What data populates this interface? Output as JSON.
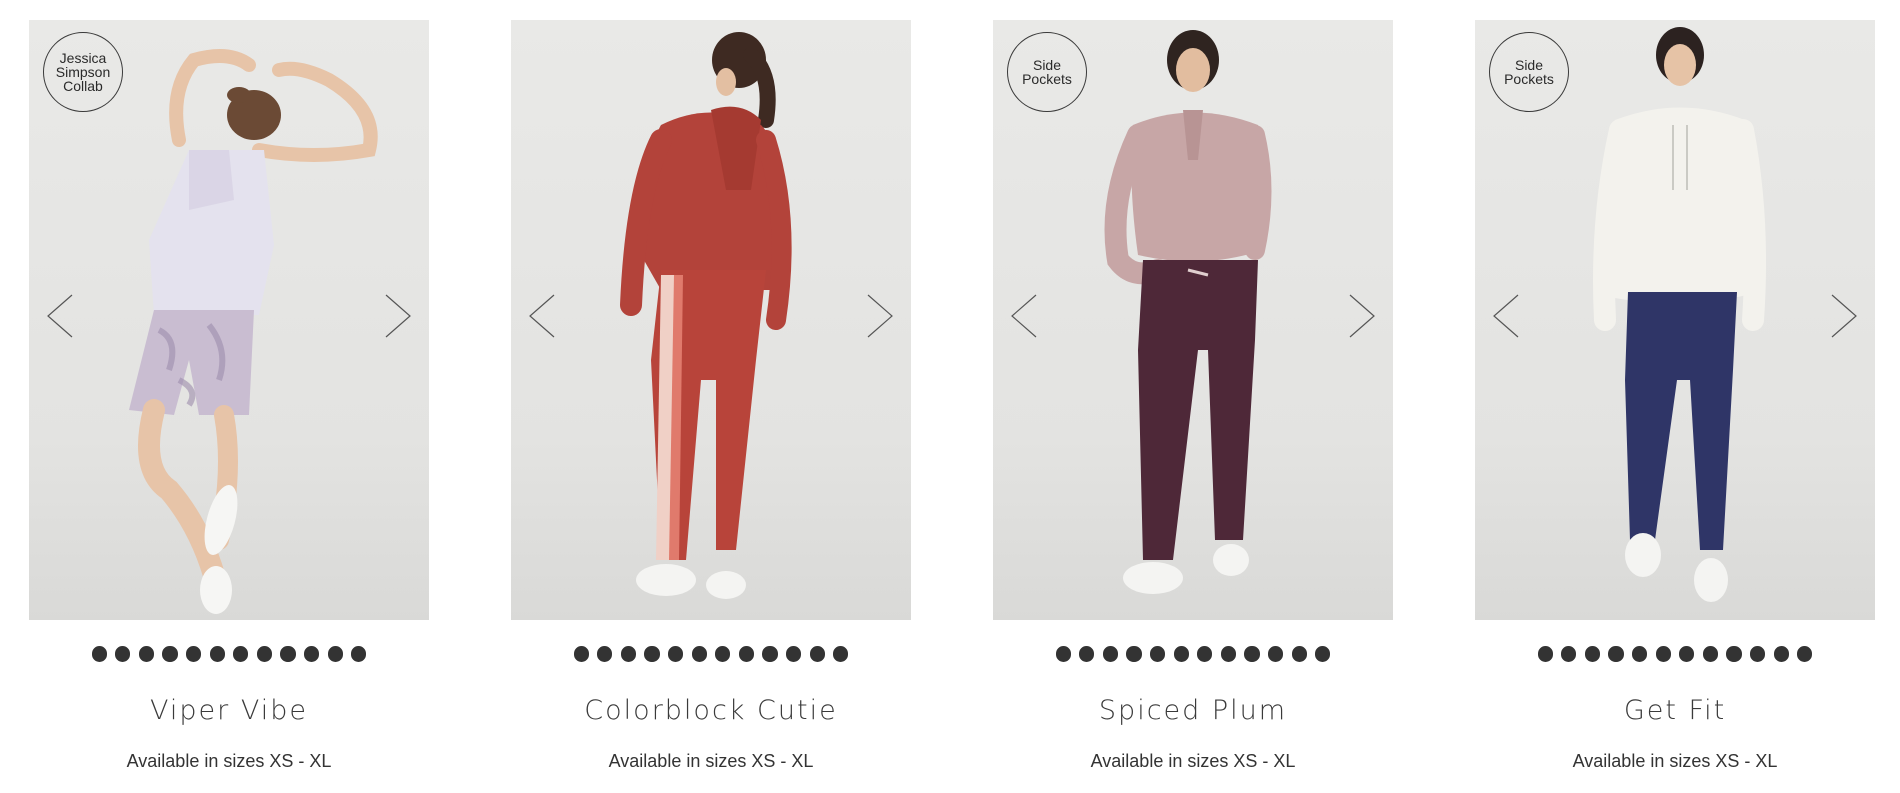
{
  "products": [
    {
      "name": "Viper Vibe",
      "sizes": "Available in sizes XS - XL",
      "badge": "Jessica Simpson Collab",
      "image_icon": "photo-model-tank-bike-shorts",
      "dot_count": 12,
      "colors": {
        "top": "#e4e2ee",
        "bottom": "#c9bdd1",
        "skin": "#e7c4a8",
        "hair": "#6b4a35"
      }
    },
    {
      "name": "Colorblock Cutie",
      "sizes": "Available in sizes XS - XL",
      "badge": "",
      "image_icon": "photo-model-red-hoodie-leggings",
      "dot_count": 12,
      "colors": {
        "top": "#b3433a",
        "bottom": "#b8443a",
        "skin": "#e3bfa2",
        "hair": "#3e2a22"
      }
    },
    {
      "name": "Spiced Plum",
      "sizes": "Available in sizes XS - XL",
      "badge": "Side Pockets",
      "image_icon": "photo-model-pink-pullover-plum-leggings",
      "dot_count": 12,
      "colors": {
        "top": "#c7a6a6",
        "bottom": "#4e2838",
        "skin": "#e2bd9f",
        "hair": "#2f2420"
      }
    },
    {
      "name": "Get Fit",
      "sizes": "Available in sizes XS - XL",
      "badge": "Side Pockets",
      "image_icon": "photo-model-white-hoodie-navy-leggings",
      "dot_count": 12,
      "colors": {
        "top": "#f3f2ed",
        "bottom": "#2f3567",
        "skin": "#e6c3a6",
        "hair": "#2c2220"
      }
    }
  ],
  "icons": {
    "prev": "chevron-left-icon",
    "next": "chevron-right-icon"
  },
  "accent": "#333333"
}
